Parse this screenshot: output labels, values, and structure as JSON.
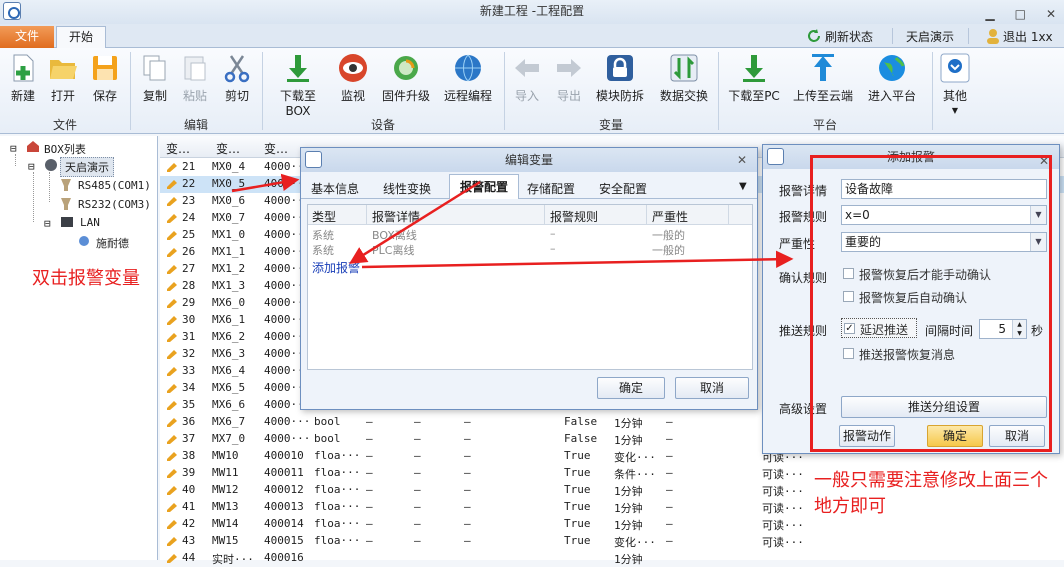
{
  "window": {
    "title": "新建工程 -工程配置",
    "min": "▁",
    "max": "□",
    "close": "✕"
  },
  "tabs": {
    "file": "文件",
    "start": "开始"
  },
  "topright": {
    "refresh": "刷新状态",
    "demo": "天启演示",
    "logout": "退出 1xx"
  },
  "ribbon": {
    "buttons": [
      "新建",
      "打开",
      "保存",
      "复制",
      "粘贴",
      "剪切",
      "下载至BOX",
      "监视",
      "固件升级",
      "远程编程",
      "导入",
      "导出",
      "模块防拆",
      "数据交换",
      "下载至PC",
      "上传至云端",
      "进入平台",
      "其他"
    ],
    "groups": [
      "文件",
      "编辑",
      "设备",
      "变量",
      "平台"
    ]
  },
  "tree": {
    "root": "BOX列表",
    "device": "天启演示",
    "rs485": "RS485(COM1)",
    "rs232": "RS232(COM3)",
    "lan": "LAN",
    "plc": "施耐德"
  },
  "grid": {
    "headers": [
      "变…",
      "变…",
      "变…"
    ],
    "rows": [
      [
        "21",
        "MX0_4",
        "4000···",
        "",
        "",
        "",
        "",
        "",
        "",
        ""
      ],
      [
        "22",
        "MX0_5",
        "4000···",
        "",
        "",
        "",
        "",
        "",
        "",
        ""
      ],
      [
        "23",
        "MX0_6",
        "4000···",
        "",
        "",
        "",
        "",
        "",
        "",
        ""
      ],
      [
        "24",
        "MX0_7",
        "4000···",
        "",
        "",
        "",
        "",
        "",
        "",
        ""
      ],
      [
        "25",
        "MX1_0",
        "4000···",
        "",
        "",
        "",
        "",
        "",
        "",
        ""
      ],
      [
        "26",
        "MX1_1",
        "4000···",
        "",
        "",
        "",
        "",
        "",
        "",
        ""
      ],
      [
        "27",
        "MX1_2",
        "4000···",
        "",
        "",
        "",
        "",
        "",
        "",
        ""
      ],
      [
        "28",
        "MX1_3",
        "4000···",
        "",
        "",
        "",
        "",
        "",
        "",
        ""
      ],
      [
        "29",
        "MX6_0",
        "4000···",
        "",
        "",
        "",
        "",
        "",
        "",
        ""
      ],
      [
        "30",
        "MX6_1",
        "4000···",
        "",
        "",
        "",
        "",
        "",
        "",
        ""
      ],
      [
        "31",
        "MX6_2",
        "4000···",
        "",
        "",
        "",
        "",
        "",
        "",
        ""
      ],
      [
        "32",
        "MX6_3",
        "4000···",
        "",
        "",
        "",
        "",
        "",
        "",
        ""
      ],
      [
        "33",
        "MX6_4",
        "4000···",
        "",
        "",
        "",
        "",
        "",
        "",
        ""
      ],
      [
        "34",
        "MX6_5",
        "4000···",
        "",
        "",
        "",
        "",
        "",
        "",
        ""
      ],
      [
        "35",
        "MX6_6",
        "4000···",
        "",
        "",
        "",
        "",
        "",
        "",
        ""
      ],
      [
        "36",
        "MX6_7",
        "4000···",
        "bool",
        "—",
        "—",
        "—",
        "False",
        "1分钟",
        "—"
      ],
      [
        "37",
        "MX7_0",
        "4000···",
        "bool",
        "—",
        "—",
        "—",
        "False",
        "1分钟",
        "—"
      ],
      [
        "38",
        "MW10",
        "400010",
        "floa···",
        "—",
        "—",
        "—",
        "True",
        "变化···",
        "—"
      ],
      [
        "39",
        "MW11",
        "400011",
        "floa···",
        "—",
        "—",
        "—",
        "True",
        "条件···",
        "—"
      ],
      [
        "40",
        "MW12",
        "400012",
        "floa···",
        "—",
        "—",
        "—",
        "True",
        "1分钟",
        "—"
      ],
      [
        "41",
        "MW13",
        "400013",
        "floa···",
        "—",
        "—",
        "—",
        "True",
        "1分钟",
        "—"
      ],
      [
        "42",
        "MW14",
        "400014",
        "floa···",
        "—",
        "—",
        "—",
        "True",
        "1分钟",
        "—"
      ],
      [
        "43",
        "MW15",
        "400015",
        "floa···",
        "—",
        "—",
        "—",
        "True",
        "变化···",
        "—"
      ],
      [
        "44",
        "实时···",
        "400016",
        "",
        "",
        "",
        "",
        "",
        "1分钟",
        ""
      ]
    ],
    "extra_col": [
      "可读···",
      "可读···",
      "可读···",
      "可读···",
      "可读···",
      "可读···",
      "可读···"
    ]
  },
  "edit_dialog": {
    "title": "编辑变量",
    "close": "✕",
    "tabs": [
      "基本信息",
      "线性变换",
      "报警配置",
      "存储配置",
      "安全配置"
    ],
    "more": "▼",
    "columns": [
      "类型",
      "报警详情",
      "报警规则",
      "严重性"
    ],
    "rows": [
      [
        "系统",
        "BOX离线",
        "–",
        "一般的"
      ],
      [
        "系统",
        "PLC离线",
        "–",
        "一般的"
      ]
    ],
    "add": "添加报警",
    "ok": "确定",
    "cancel": "取消"
  },
  "alarm_dialog": {
    "title": "添加报警",
    "close": "✕",
    "detail_label": "报警详情",
    "detail_value": "设备故障",
    "rule_label": "报警规则",
    "rule_value": "x=0",
    "severity_label": "严重性",
    "severity_value": "重要的",
    "confirm_label": "确认规则",
    "confirm_opt1": "报警恢复后才能手动确认",
    "confirm_opt2": "报警恢复后自动确认",
    "push_label": "推送规则",
    "delay": "延迟推送",
    "interval_label": "间隔时间",
    "interval_value": "5",
    "unit": "秒",
    "push_recover": "推送报警恢复消息",
    "advanced_label": "高级设置",
    "group_btn": "推送分组设置",
    "action_btn": "报警动作",
    "ok": "确定",
    "cancel": "取消"
  },
  "annotations": {
    "left": "双击报警变量",
    "right": "一般只需要注意修改上面三个地方即可"
  },
  "colors": {
    "accent": "#e82020",
    "file_tab": "#e06d1f",
    "selection": "#cde3f7"
  }
}
